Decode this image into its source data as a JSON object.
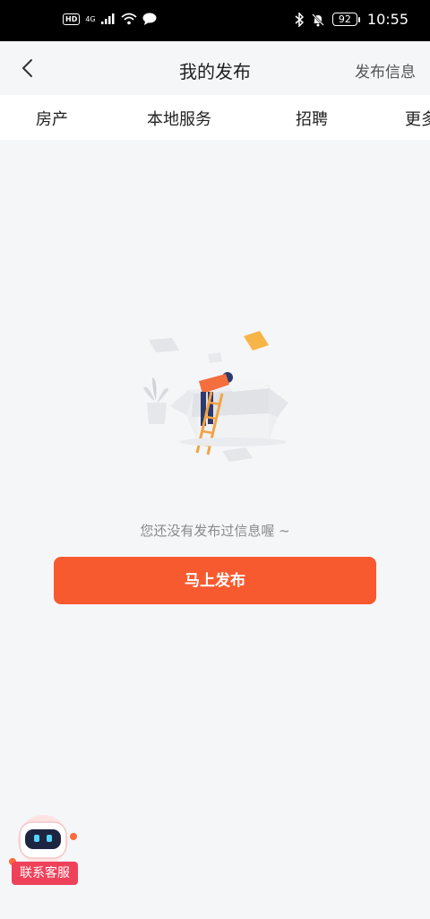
{
  "status_bar": {
    "hd": "HD",
    "network": "4G",
    "battery": "92",
    "time": "10:55"
  },
  "nav": {
    "title": "我的发布",
    "action": "发布信息"
  },
  "tabs": [
    {
      "label": "房产"
    },
    {
      "label": "本地服务"
    },
    {
      "label": "招聘"
    },
    {
      "label": "更多"
    }
  ],
  "empty": {
    "message": "您还没有发布过信息喔 ~",
    "button": "马上发布"
  },
  "support": {
    "label": "联系客服"
  },
  "colors": {
    "accent": "#f85a2f",
    "support": "#f0415a"
  }
}
